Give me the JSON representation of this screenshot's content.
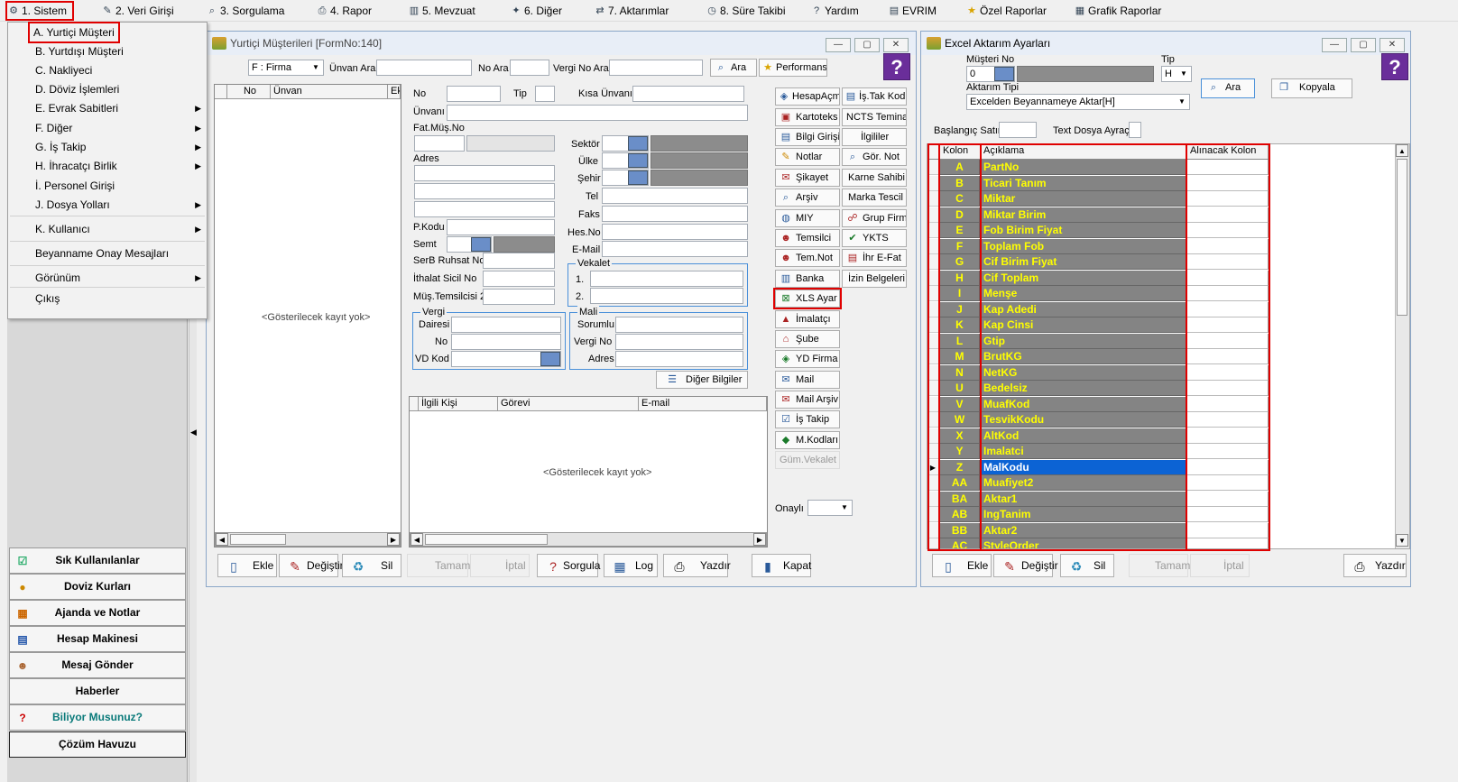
{
  "menubar": {
    "items": [
      "1.  Sistem",
      "2.  Veri Girişi",
      "3.  Sorgulama",
      "4.  Rapor",
      "5.  Mevzuat",
      "6.  Diğer",
      "7.  Aktarımlar",
      "8. Süre Takibi",
      "Yardım",
      "EVRIM",
      "Özel Raporlar",
      "Grafik Raporlar"
    ]
  },
  "sistem_menu": {
    "items": [
      "A.   Yurtiçi Müşteri",
      "B.   Yurtdışı Müşteri",
      "C.   Nakliyeci",
      "D.   Döviz İşlemleri",
      "E.   Evrak Sabitleri",
      "F.   Diğer",
      "G.   İş Takip",
      "H.   İhracatçı Birlik",
      "İ.    Personel Girişi",
      "J.   Dosya Yolları",
      "K.   Kullanıcı",
      "Beyanname Onay Mesajları",
      "Görünüm",
      "Çıkış"
    ]
  },
  "left_panel": {
    "buttons": [
      "Sık Kullanılanlar",
      "Doviz Kurları",
      "Ajanda ve Notlar",
      "Hesap Makinesi",
      "Mesaj Gönder",
      "Haberler",
      "Biliyor Musunuz?",
      "Çözüm Havuzu"
    ],
    "biliyor_color": "#0a7a7a"
  },
  "customers_window": {
    "title": "Yurtiçi Müşterileri [FormNo:140]",
    "filter_combo": "F : Firma",
    "unvan_ara_label": "Ünvan Ara",
    "no_ara_label": "No Ara",
    "vergi_no_ara_label": "Vergi No Ara",
    "ara_button": "Ara",
    "performans_button": "Performans",
    "list_headers": [
      "No",
      "Ünvan",
      "Ek"
    ],
    "empty_message": "<Gösterilecek kayıt yok>",
    "labels": {
      "no": "No",
      "tip": "Tip",
      "kisa_unvani": "Kısa Ünvanı",
      "unvani": "Ünvanı",
      "fat_mus_no": "Fat.Müş.No",
      "adres": "Adres",
      "sektor": "Sektör",
      "ulke": "Ülke",
      "sehir": "Şehir",
      "tel": "Tel",
      "faks": "Faks",
      "hes_no": "Hes.No",
      "email": "E-Mail",
      "pkodu": "P.Kodu",
      "semt": "Semt",
      "serb_ruhsat_no": "SerB Ruhsat No",
      "ithalat_sicil_no": "İthalat Sicil No",
      "mus_temsilcisi2": "Müş.Temsilcisi 2",
      "vekalet": "Vekalet",
      "vekalet_1": "1.",
      "vekalet_2": "2.",
      "vergi": "Vergi",
      "dairesi": "Dairesi",
      "vergi_no": "No",
      "vd_kod": "VD Kod",
      "mali": "Mali",
      "sorumlu": "Sorumlu",
      "mali_vergi_no": "Vergi No",
      "mali_adres": "Adres",
      "onayli": "Onaylı"
    },
    "diger_bilgiler_button": "Diğer Bilgiler",
    "contact_headers": [
      "İlgili Kişi",
      "Görevi",
      "E-mail"
    ],
    "contact_empty": "<Gösterilecek kayıt yok>",
    "side_buttons_left": [
      "HesapAçma",
      "Kartoteks",
      "Bilgi Girişi",
      "Notlar",
      "Şikayet",
      "Arşiv",
      "MIY",
      "Temsilci",
      "Tem.Not",
      "Banka",
      "XLS Ayar",
      "İmalatçı",
      "Şube",
      "YD Firma",
      "Mail",
      "Mail Arşiv",
      "İş Takip",
      "M.Kodları",
      "Güm.Vekalet"
    ],
    "side_buttons_right": [
      "İş.Tak Kod",
      "NCTS Teminat",
      "İlgililer",
      "Gör. Not",
      "Karne Sahibi",
      "Marka Tescil",
      "Grup Firma",
      "YKTS",
      "İhr E-Fat",
      "İzin Belgeleri"
    ],
    "bottom_buttons": [
      "Ekle",
      "Değiştir",
      "Sil",
      "Tamam",
      "İptal",
      "Sorgula",
      "Log",
      "Yazdır",
      "Kapat"
    ]
  },
  "excel_window": {
    "title": "Excel Aktarım Ayarları",
    "musteri_no_label": "Müşteri No",
    "musteri_no_value": "0",
    "tip_label": "Tip",
    "tip_value": "H",
    "aktarim_tipi_label": "Aktarım Tipi",
    "aktarim_tipi_value": "Excelden Beyannameye Aktar[H]",
    "ara_button": "Ara",
    "kopyala_button": "Kopyala",
    "baslangic_satir_label": "Başlangıç Satır",
    "text_dosya_ayrac_label": "Text Dosya Ayraç",
    "grid_headers": [
      "Kolon",
      "Açıklama",
      "Alınacak Kolon"
    ],
    "rows": [
      {
        "kolon": "A",
        "aciklama": "PartNo"
      },
      {
        "kolon": "B",
        "aciklama": "Ticari Tanım"
      },
      {
        "kolon": "C",
        "aciklama": "Miktar"
      },
      {
        "kolon": "D",
        "aciklama": "Miktar Birim"
      },
      {
        "kolon": "E",
        "aciklama": "Fob Birim Fiyat"
      },
      {
        "kolon": "F",
        "aciklama": "Toplam Fob"
      },
      {
        "kolon": "G",
        "aciklama": "Cif Birim Fiyat"
      },
      {
        "kolon": "H",
        "aciklama": "Cif Toplam"
      },
      {
        "kolon": "I",
        "aciklama": "Menşe"
      },
      {
        "kolon": "J",
        "aciklama": "Kap Adedi"
      },
      {
        "kolon": "K",
        "aciklama": "Kap Cinsi"
      },
      {
        "kolon": "L",
        "aciklama": "Gtip"
      },
      {
        "kolon": "M",
        "aciklama": "BrutKG"
      },
      {
        "kolon": "N",
        "aciklama": "NetKG"
      },
      {
        "kolon": "U",
        "aciklama": "Bedelsiz"
      },
      {
        "kolon": "V",
        "aciklama": "MuafKod"
      },
      {
        "kolon": "W",
        "aciklama": "TesvikKodu"
      },
      {
        "kolon": "X",
        "aciklama": "AltKod"
      },
      {
        "kolon": "Y",
        "aciklama": "Imalatci"
      },
      {
        "kolon": "Z",
        "aciklama": "MalKodu",
        "selected": true
      },
      {
        "kolon": "AA",
        "aciklama": "Muafiyet2"
      },
      {
        "kolon": "BA",
        "aciklama": "Aktar1"
      },
      {
        "kolon": "AB",
        "aciklama": "IngTanim"
      },
      {
        "kolon": "BB",
        "aciklama": "Aktar2"
      },
      {
        "kolon": "AC",
        "aciklama": "StyleOrder"
      }
    ],
    "bottom_buttons": [
      "Ekle",
      "Değiştir",
      "Sil",
      "Tamam",
      "İptal",
      "Yazdır"
    ]
  },
  "colors": {
    "highlight_red": "#e00000",
    "grid_grey": "#848484",
    "grid_text": "#ffff00",
    "selected_row": "#0c63d4",
    "help_purple": "#6a2e9a",
    "groupbox_blue": "#4a90d9"
  }
}
